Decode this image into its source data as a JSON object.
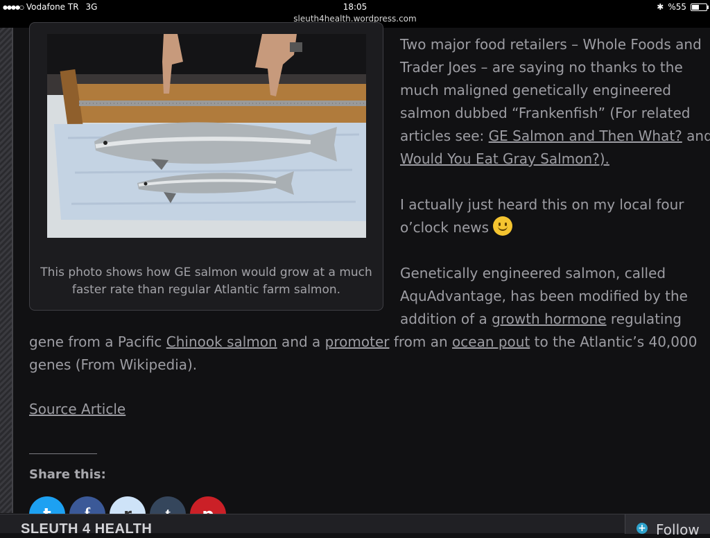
{
  "status_bar": {
    "signal": "●●●●○",
    "carrier": "Vodafone TR",
    "network": "3G",
    "time": "18:05",
    "url": "sleuth4health.wordpress.com",
    "bluetooth": "✱",
    "battery": "%55"
  },
  "figure": {
    "caption": "This photo shows how GE salmon would grow at a much faster rate than regular Atlantic farm salmon."
  },
  "article": {
    "p1_text1": "Two major food retailers – Whole Foods and Trader Joes – are saying no thanks to the much maligned genetically engineered salmon dubbed “Frankenfish” (For related articles see:  ",
    "p1_link1": "GE Salmon and Then What?",
    "p1_text2": " and ",
    "p1_link2": "Would You Eat Gray Salmon?).",
    "p2_text": "I actually just heard this on my local four o’clock news ",
    "p3_text1": "Genetically engineered salmon, called AquAdvantage, has been modified by the addition of a ",
    "p3_link1": "growth hormone",
    "p3_text2": " regulating gene from a Pacific ",
    "p3_link2": "Chinook salmon",
    "p3_text3": " and a ",
    "p3_link3": "promoter",
    "p3_text4": " from an ",
    "p3_link4": "ocean pout",
    "p3_text5": " to the Atlantic’s 40,000 genes (From Wikipedia)."
  },
  "source_link": "Source Article",
  "share": {
    "heading": "Share this:",
    "twitter": "t",
    "facebook": "f",
    "reddit": "r",
    "tumblr": "t",
    "pinterest": "p"
  },
  "bottom_bar": {
    "site_name": "SLEUTH 4 HEALTH",
    "follow_label": "Follow",
    "follow_icon": "+"
  }
}
